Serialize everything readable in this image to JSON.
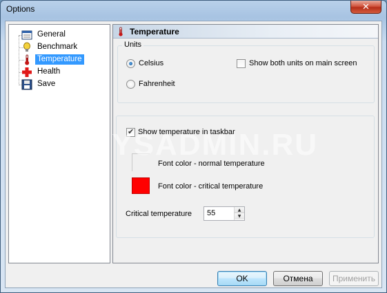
{
  "window": {
    "title": "Options",
    "close_glyph": "✕"
  },
  "tree": {
    "items": [
      {
        "label": "General",
        "icon": "general-window-icon"
      },
      {
        "label": "Benchmark",
        "icon": "lightbulb-icon"
      },
      {
        "label": "Temperature",
        "icon": "thermometer-icon",
        "selected": true
      },
      {
        "label": "Health",
        "icon": "red-cross-icon"
      },
      {
        "label": "Save",
        "icon": "floppy-disk-icon"
      }
    ]
  },
  "panel": {
    "title": "Temperature",
    "units": {
      "legend": "Units",
      "celsius_label": "Celsius",
      "celsius_checked": true,
      "fahrenheit_label": "Fahrenheit",
      "fahrenheit_checked": false,
      "show_both_label": "Show both units on main screen",
      "show_both_checked": false
    },
    "taskbar": {
      "show_in_taskbar_label": "Show temperature in taskbar",
      "show_in_taskbar_checked": true,
      "normal_color_label": "Font color - normal temperature",
      "normal_color": "#ffffff",
      "critical_color_label": "Font color - critical temperature",
      "critical_color": "#ff0000",
      "critical_temp_label": "Critical temperature",
      "critical_temp_value": "55"
    }
  },
  "buttons": {
    "ok": "OK",
    "cancel": "Отмена",
    "apply": "Применить"
  },
  "watermark": "SYSADMIN.RU"
}
